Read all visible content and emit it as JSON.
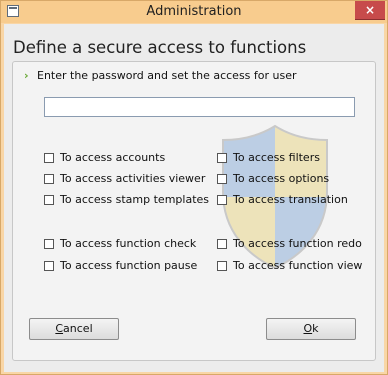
{
  "window": {
    "title": "Administration",
    "close_glyph": "×",
    "icon": "window-app-icon"
  },
  "heading": "Define a secure access to functions",
  "instruction": {
    "arrow": "›",
    "text": "Enter the password and set the access for user"
  },
  "password_input": {
    "value": "",
    "placeholder": ""
  },
  "permissions": {
    "left": [
      "To access accounts",
      "To access activities viewer",
      "To access stamp templates",
      "To access function check",
      "To access function pause"
    ],
    "right": [
      "To access filters",
      "To access options",
      "To access translation",
      "To access function redo",
      "To access function view"
    ]
  },
  "buttons": {
    "cancel_mnemonic": "C",
    "cancel_rest": "ancel",
    "ok_mnemonic": "O",
    "ok_rest": "k"
  },
  "colors": {
    "title_bar": "#f8cc8e",
    "close_button": "#c74b4b",
    "client_bg": "#ececec",
    "arrow_green": "#68a834"
  }
}
